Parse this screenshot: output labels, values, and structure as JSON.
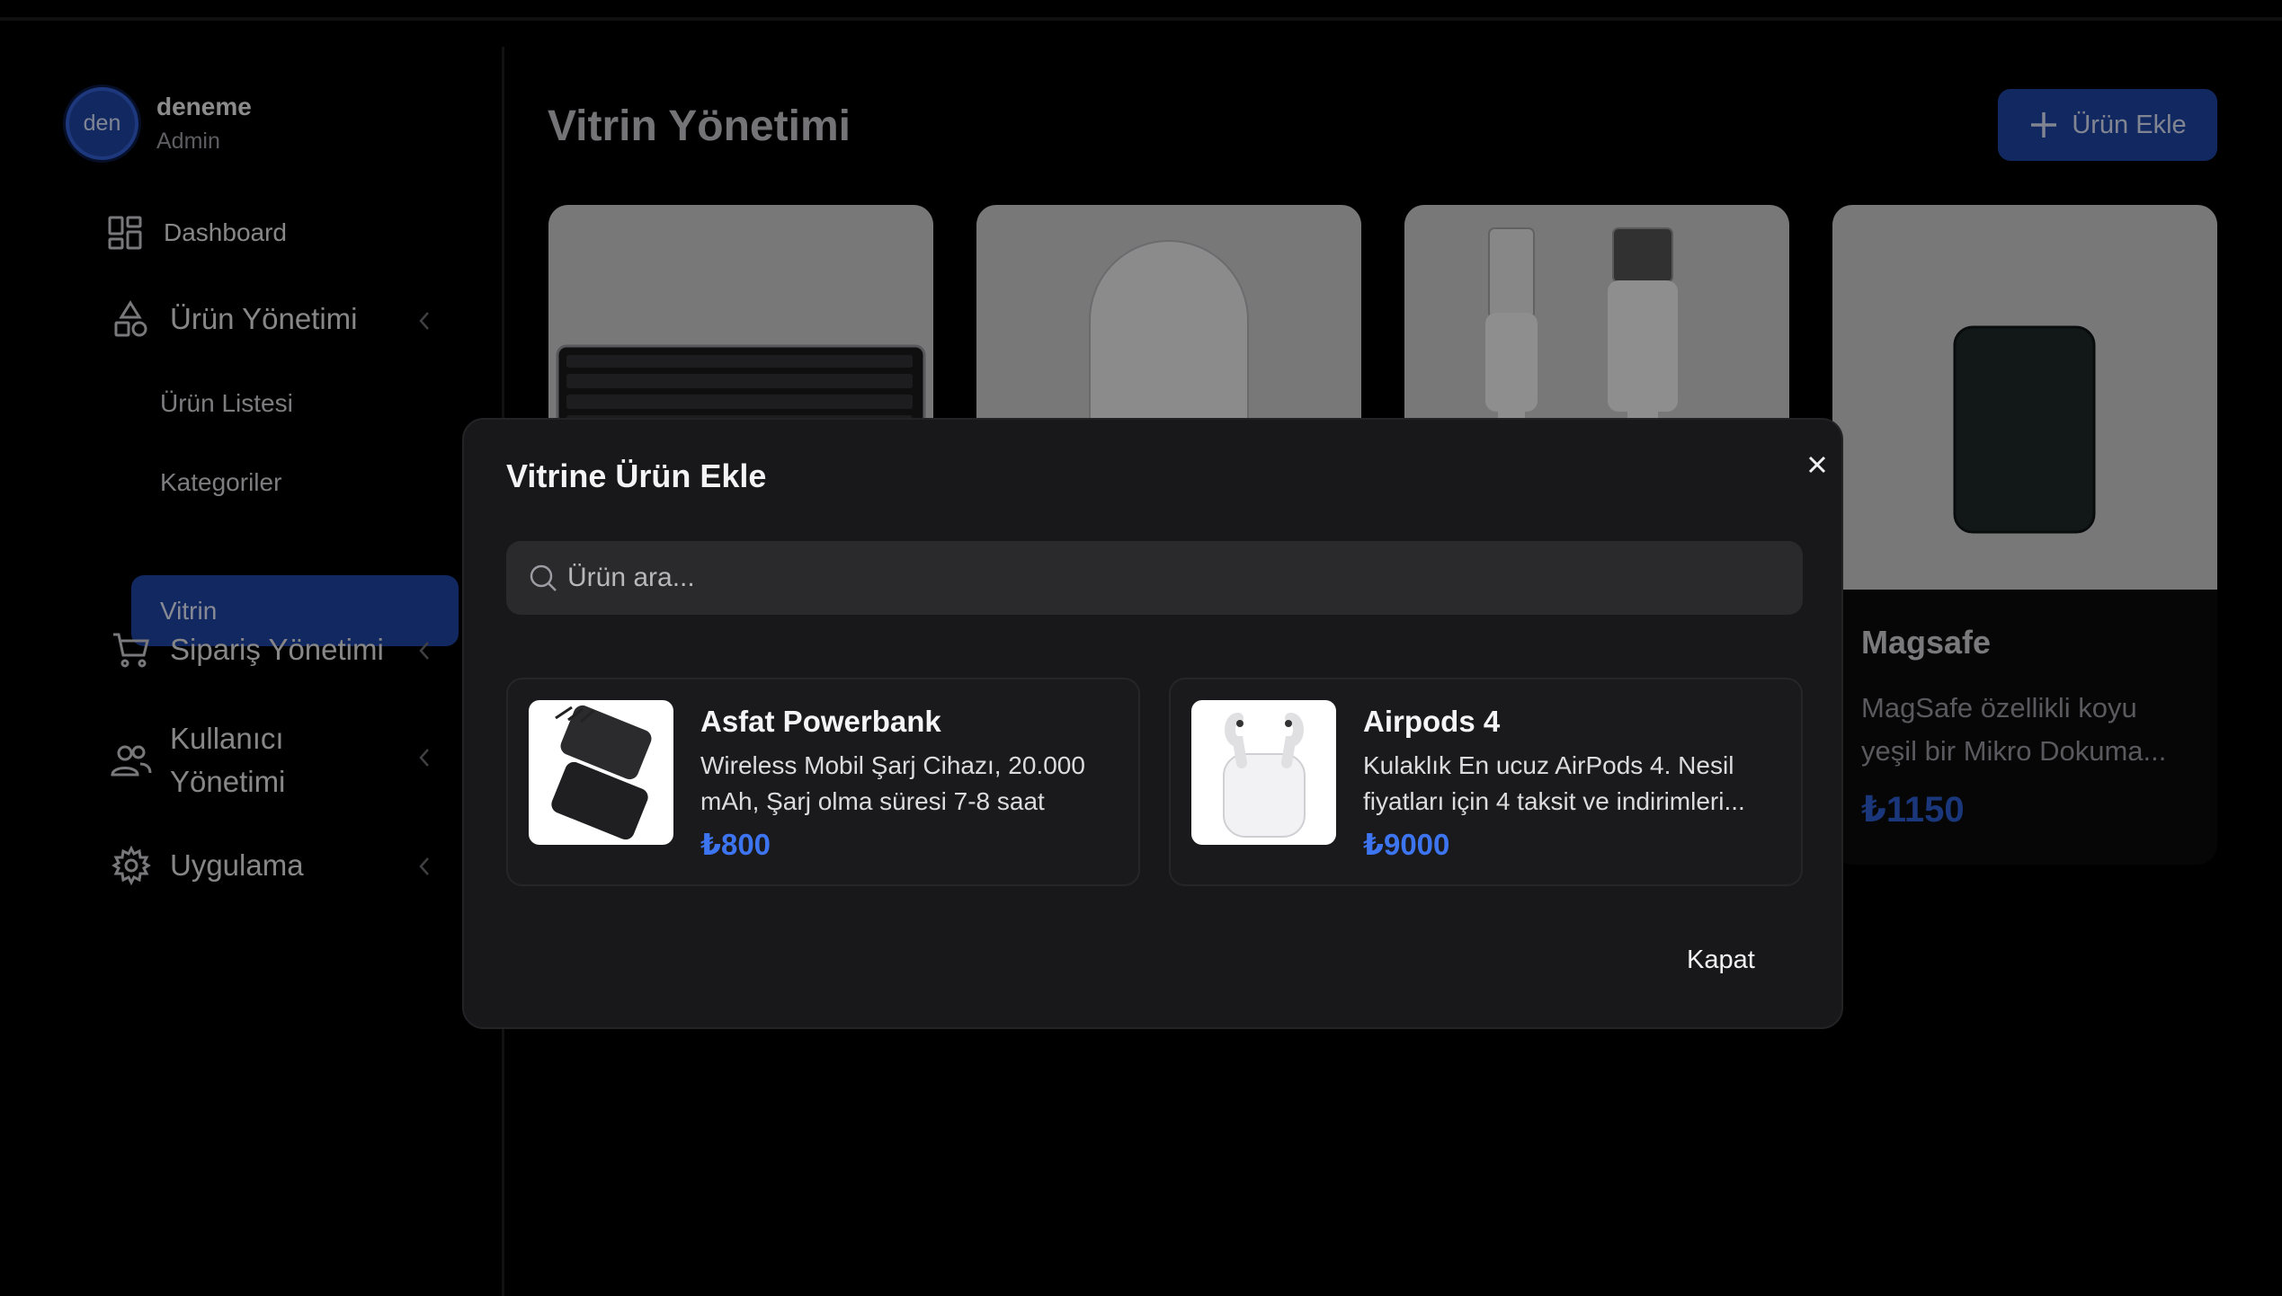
{
  "user": {
    "avatar_initials": "den",
    "name": "deneme",
    "role": "Admin"
  },
  "sidebar": {
    "items": [
      {
        "label": "Dashboard",
        "icon": "dashboard-icon"
      },
      {
        "label": "Ürün Yönetimi",
        "icon": "shapes-icon"
      },
      {
        "label": "Ürün Listesi"
      },
      {
        "label": "Kategoriler"
      },
      {
        "label": "Vitrin",
        "active": true
      },
      {
        "label": "Sipariş Yönetimi",
        "icon": "cart-icon"
      },
      {
        "label_line1": "Kullanıcı",
        "label_line2": "Yönetimi",
        "icon": "users-icon"
      },
      {
        "label": "Uygulama",
        "icon": "gear-icon"
      }
    ]
  },
  "main": {
    "title": "Vitrin Yönetimi",
    "add_button": "Ürün Ekle",
    "cards": [
      {
        "image": "keyboard"
      },
      {
        "image": "mouse"
      },
      {
        "image": "cables"
      },
      {
        "image": "magsafe-wallet",
        "title": "Magsafe",
        "desc_line1": "MagSafe özellikli koyu",
        "desc_line2": "yeşil bir Mikro Dokuma...",
        "price": "₺1150"
      }
    ]
  },
  "modal": {
    "title": "Vitrine Ürün Ekle",
    "search_placeholder": "Ürün ara...",
    "close_button": "Kapat",
    "results": [
      {
        "title": "Asfat Powerbank",
        "desc_line1": "Wireless Mobil Şarj Cihazı, 20.000",
        "desc_line2": "mAh, Şarj olma süresi 7-8 saat",
        "price": "₺800",
        "image": "powerbank"
      },
      {
        "title": "Airpods 4",
        "desc_line1": "Kulaklık En ucuz AirPods 4. Nesil",
        "desc_line2": "fiyatları için 4 taksit ve indirimleri...",
        "price": "₺9000",
        "image": "airpods"
      }
    ]
  },
  "colors": {
    "accent": "#1f45a8",
    "price": "#3d74f0",
    "modal_bg": "#18181a"
  }
}
